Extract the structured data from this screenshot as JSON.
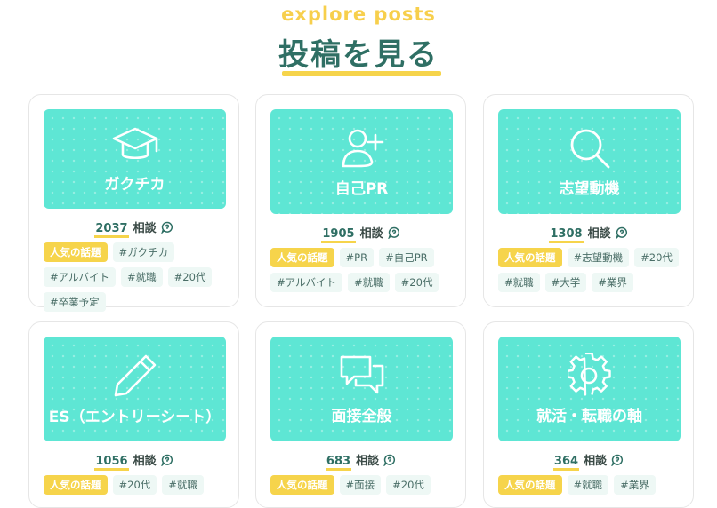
{
  "header": {
    "eyebrow": "explore posts",
    "title": "投稿を見る"
  },
  "cards": [
    {
      "label": "ガクチカ",
      "icon": "graduation-cap-icon",
      "count": "2037",
      "count_suffix": "相談",
      "tags": [
        "人気の話題",
        "#ガクチカ",
        "#アルバイト",
        "#就職",
        "#20代",
        "#卒業予定"
      ]
    },
    {
      "label": "自己PR",
      "icon": "user-plus-icon",
      "count": "1905",
      "count_suffix": "相談",
      "tags": [
        "人気の話題",
        "#PR",
        "#自己PR",
        "#アルバイト",
        "#就職",
        "#20代"
      ]
    },
    {
      "label": "志望動機",
      "icon": "search-icon",
      "count": "1308",
      "count_suffix": "相談",
      "tags": [
        "人気の話題",
        "#志望動機",
        "#20代",
        "#就職",
        "#大学",
        "#業界"
      ]
    },
    {
      "label": "ES（エントリーシート）",
      "icon": "pencil-icon",
      "count": "1056",
      "count_suffix": "相談",
      "tags": [
        "人気の話題",
        "#20代",
        "#就職"
      ]
    },
    {
      "label": "面接全般",
      "icon": "chat-bubbles-icon",
      "count": "683",
      "count_suffix": "相談",
      "tags": [
        "人気の話題",
        "#面接",
        "#20代"
      ]
    },
    {
      "label": "就活・転職の軸",
      "icon": "gear-icon",
      "count": "364",
      "count_suffix": "相談",
      "tags": [
        "人気の話題",
        "#就職",
        "#業界"
      ]
    }
  ],
  "colors": {
    "accent_yellow": "#f6d44b",
    "thumb_teal": "#5ee6d4",
    "title_green": "#2f6f64"
  }
}
